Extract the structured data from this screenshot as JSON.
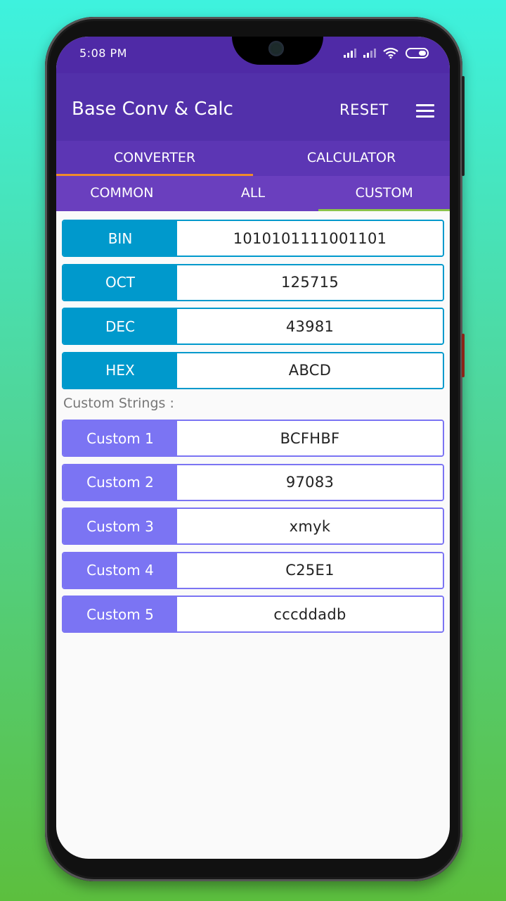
{
  "status_bar": {
    "time": "5:08 PM",
    "icons": [
      "signal-icon",
      "signal-icon",
      "wifi-icon",
      "battery-icon"
    ]
  },
  "app_bar": {
    "title": "Base Conv & Calc",
    "reset_label": "RESET",
    "menu_icon": "hamburger-menu-icon"
  },
  "main_tabs": [
    {
      "label": "CONVERTER",
      "active": true
    },
    {
      "label": "CALCULATOR",
      "active": false
    }
  ],
  "sub_tabs": [
    {
      "label": "COMMON",
      "active": false
    },
    {
      "label": "ALL",
      "active": false
    },
    {
      "label": "CUSTOM",
      "active": true
    }
  ],
  "bases": [
    {
      "label": "BIN",
      "value": "1010101111001101"
    },
    {
      "label": "OCT",
      "value": "125715"
    },
    {
      "label": "DEC",
      "value": "43981"
    },
    {
      "label": "HEX",
      "value": "ABCD"
    }
  ],
  "custom_section_label": "Custom Strings :",
  "customs": [
    {
      "label": "Custom 1",
      "value": "BCFHBF"
    },
    {
      "label": "Custom 2",
      "value": "97083"
    },
    {
      "label": "Custom 3",
      "value": "xmyk"
    },
    {
      "label": "Custom 4",
      "value": "C25E1"
    },
    {
      "label": "Custom 5",
      "value": "cccddadb"
    }
  ],
  "colors": {
    "app_bar": "#5230aa",
    "base_accent": "#0099cc",
    "custom_accent": "#7b74f3",
    "main_tab_indicator": "#f08b2c",
    "sub_tab_indicator": "#8bc34a"
  }
}
